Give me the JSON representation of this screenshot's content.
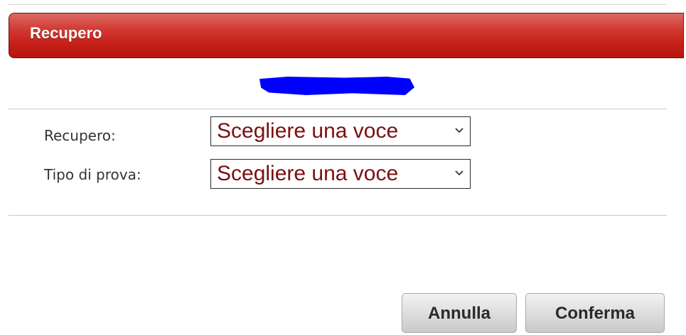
{
  "dialog": {
    "title": "Recupero"
  },
  "form": {
    "fields": [
      {
        "label": "Recupero:",
        "selected": "Scegliere una voce"
      },
      {
        "label": "Tipo di prova:",
        "selected": "Scegliere una voce"
      }
    ]
  },
  "buttons": {
    "cancel_label": "Annulla",
    "confirm_label": "Conferma"
  },
  "colors": {
    "title_bar": "#c41f17",
    "select_text": "#7a1010",
    "redaction": "#0000ff"
  },
  "icons": {
    "select_arrow": "chevron-down-icon"
  }
}
